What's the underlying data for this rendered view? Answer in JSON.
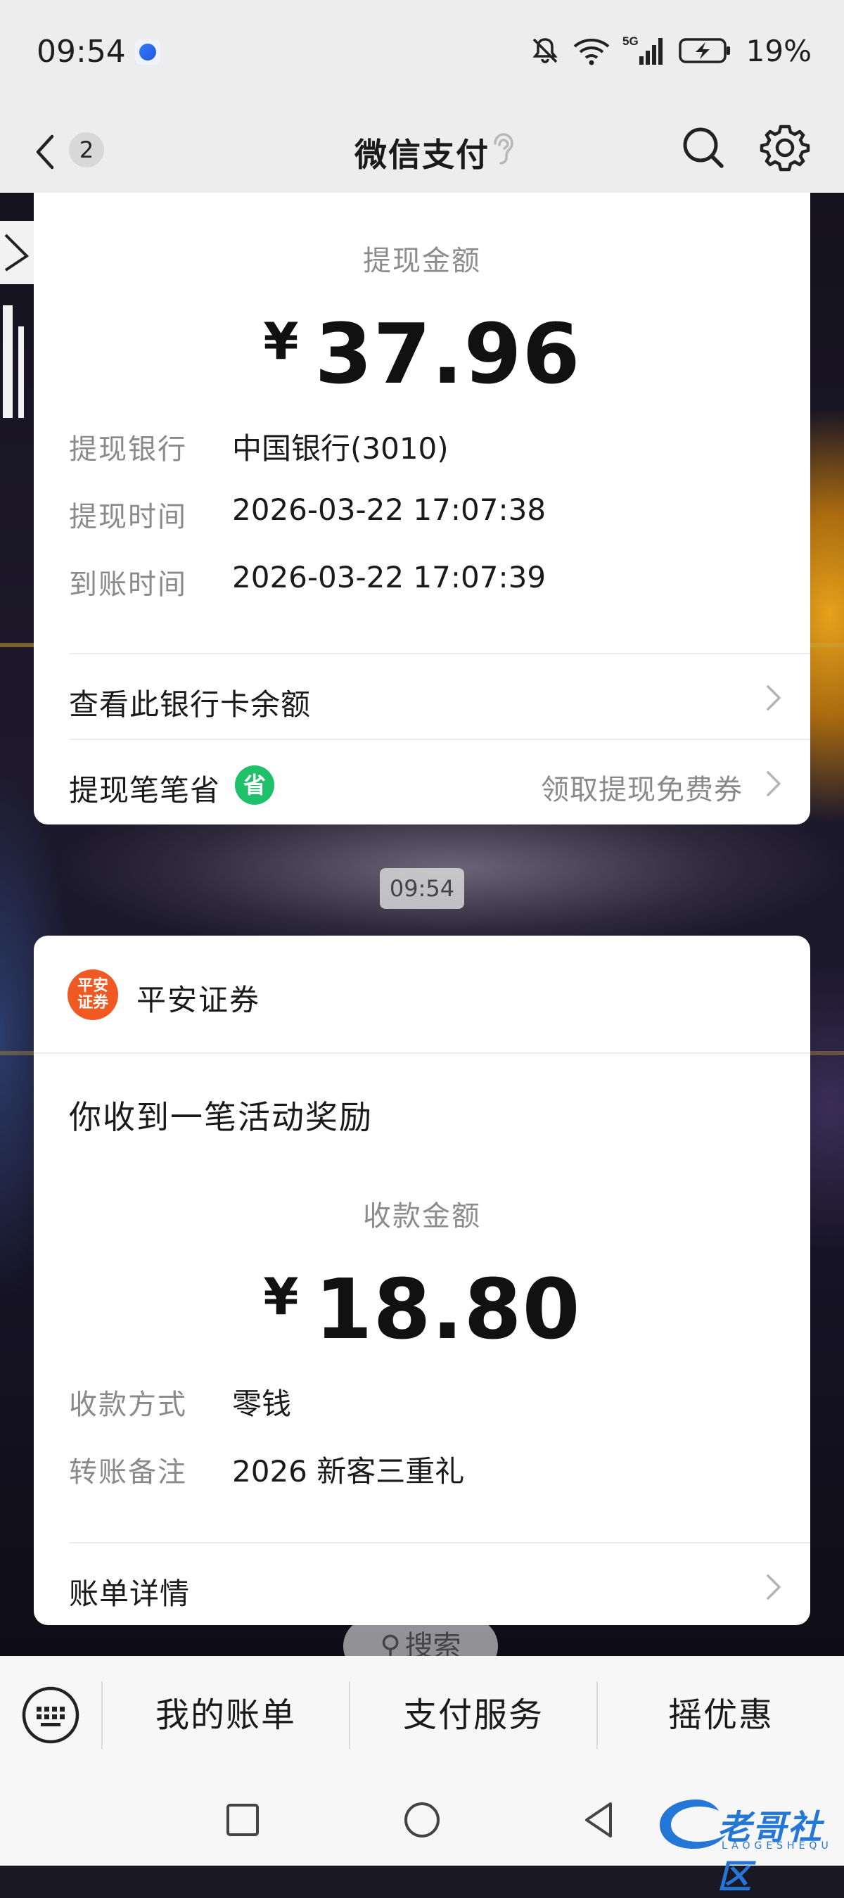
{
  "status_bar": {
    "time": "09:54",
    "network": "5G",
    "battery": "19%"
  },
  "header": {
    "back_icon": "chevron-left-icon",
    "unread_count": "2",
    "title": "微信支付",
    "ear_icon": "ear-icon",
    "search_icon": "search-icon",
    "settings_icon": "gear-icon"
  },
  "withdrawal_card": {
    "amount_label": "提现金额",
    "currency": "¥",
    "amount": "37.96",
    "rows": [
      {
        "label": "提现银行",
        "value": "中国银行(3010)"
      },
      {
        "label": "提现时间",
        "value": "2026-03-22 17:07:38"
      },
      {
        "label": "到账时间",
        "value": "2026-03-22 17:07:39"
      }
    ],
    "balance_link": "查看此银行卡余额",
    "savings_link": "提现笔笔省",
    "savings_badge": "省",
    "coupon_link": "领取提现免费券"
  },
  "message_time": "09:54",
  "reward_card": {
    "sender_logo_text": "平安证券",
    "sender_name": "平安证券",
    "headline": "你收到一笔活动奖励",
    "amount_label": "收款金额",
    "currency": "¥",
    "amount": "18.80",
    "rows": [
      {
        "label": "收款方式",
        "value": "零钱"
      },
      {
        "label": "转账备注",
        "value": "2026 新客三重礼"
      }
    ],
    "details_link": "账单详情"
  },
  "background_search": "搜索",
  "bottom_menu": {
    "items": [
      "我的账单",
      "支付服务",
      "摇优惠"
    ]
  },
  "watermark": {
    "text": "老哥社区",
    "sub": "LAOGESHEQU"
  },
  "colors": {
    "accent_green": "#1ec06a",
    "sender_orange": "#f05a22",
    "watermark_blue": "#2477d6"
  }
}
